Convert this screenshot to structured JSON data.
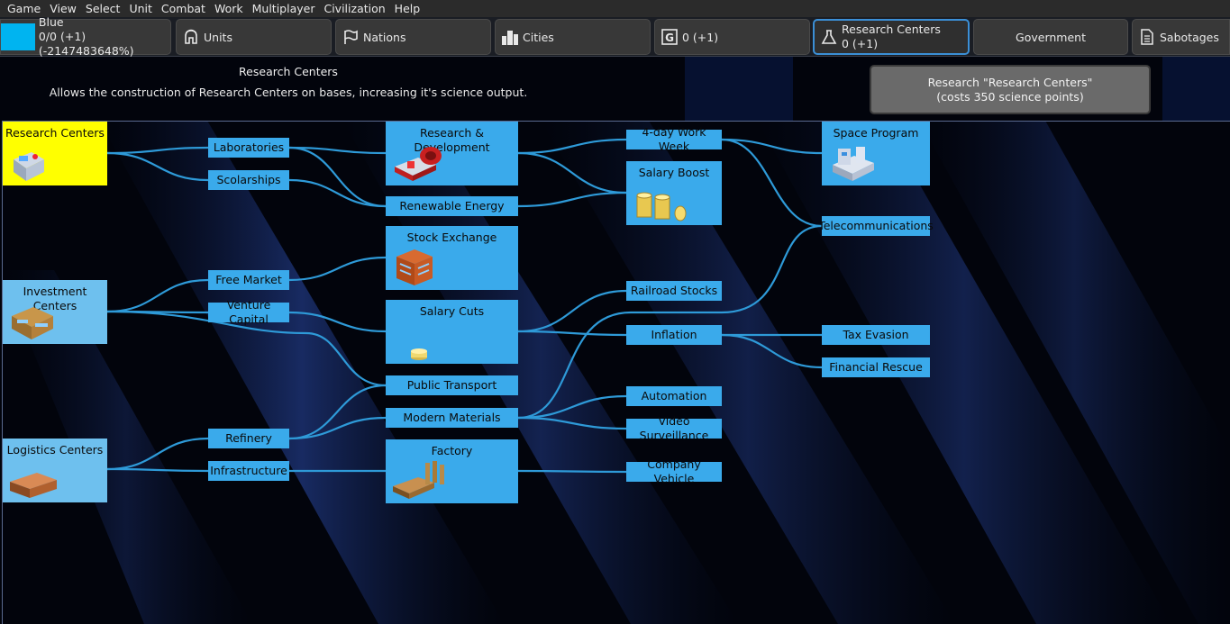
{
  "menu": [
    "Game",
    "View",
    "Select",
    "Unit",
    "Combat",
    "Work",
    "Multiplayer",
    "Civilization",
    "Help"
  ],
  "player": {
    "name": "Blue",
    "stats": "0/0 (+1) (-2147483648%)",
    "color": "#00b4f0"
  },
  "tabs": {
    "units": "Units",
    "nations": "Nations",
    "cities": "Cities",
    "gold": "0 (+1)",
    "research_title": "Research Centers",
    "research_value": "0 (+1)",
    "government": "Government",
    "sabotages": "Sabotages"
  },
  "selected": {
    "title": "Research Centers",
    "description": "Allows the construction of Research Centers on bases, increasing it's science output."
  },
  "research_button": {
    "line1": "Research \"Research Centers\"",
    "line2": "(costs 350 science points)"
  },
  "nodes": {
    "research_centers": "Research Centers",
    "investment_centers": "Investment Centers",
    "logistics_centers": "Logistics Centers",
    "laboratories": "Laboratories",
    "scolarships": "Scolarships",
    "free_market": "Free Market",
    "venture_capital": "Venture Capital",
    "refinery": "Refinery",
    "infrastructure": "Infrastructure",
    "research_development": "Research & Development",
    "renewable_energy": "Renewable Energy",
    "stock_exchange": "Stock Exchange",
    "salary_cuts": "Salary Cuts",
    "public_transport": "Public Transport",
    "modern_materials": "Modern Materials",
    "factory": "Factory",
    "work_week": "4-day Work Week",
    "salary_boost": "Salary Boost",
    "railroad_stocks": "Railroad Stocks",
    "inflation": "Inflation",
    "automation": "Automation",
    "video_surveillance": "Video Surveillance",
    "company_vehicle": "Company Vehicle",
    "space_program": "Space Program",
    "telecommunications": "Telecommunications",
    "tax_evasion": "Tax Evasion",
    "financial_rescue": "Financial Rescue"
  },
  "colors": {
    "node": "#3aaaeb",
    "node_selected": "#ffff00",
    "link": "#2e9ad8",
    "active_tab_border": "#3b8fd6"
  }
}
